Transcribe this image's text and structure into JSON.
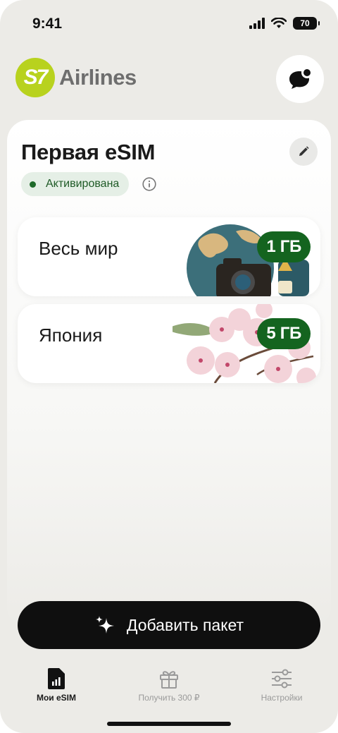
{
  "status_bar": {
    "time": "9:41",
    "battery": "70"
  },
  "header": {
    "logo_mark": "S7",
    "logo_text": "Airlines"
  },
  "esim": {
    "title": "Первая eSIM",
    "status": "Активирована",
    "packages": [
      {
        "name": "Весь мир",
        "data": "1 ГБ"
      },
      {
        "name": "Япония",
        "data": "5 ГБ"
      }
    ]
  },
  "actions": {
    "add_package": "Добавить пакет"
  },
  "tabs": [
    {
      "label": "Мои eSIM",
      "active": true
    },
    {
      "label": "Получить 300 ₽",
      "active": false
    },
    {
      "label": "Настройки",
      "active": false
    }
  ],
  "colors": {
    "brand": "#b8d21e",
    "accent_green": "#14641f",
    "button": "#0f0f0f"
  }
}
